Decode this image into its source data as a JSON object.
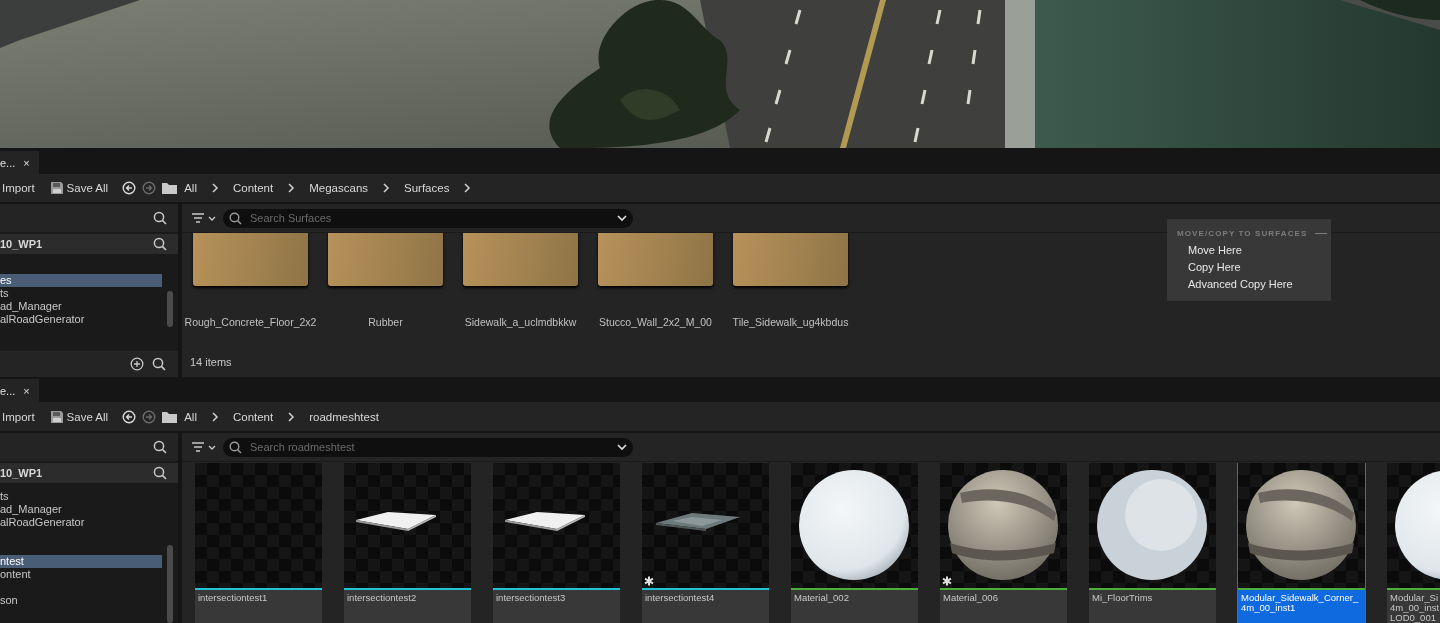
{
  "browsers": [
    {
      "tab": {
        "label": "e...",
        "close": "×"
      },
      "toolbar": {
        "import": "Import",
        "save_all": "Save All"
      },
      "breadcrumbs": [
        "All",
        "Content",
        "Megascans",
        "Surfaces"
      ],
      "trailing_chevron": true,
      "sidebar": {
        "header": "10_WP1",
        "footer": true,
        "items": [
          {
            "kind": "spacer"
          },
          {
            "kind": "spacer"
          },
          {
            "kind": "item",
            "label": "es",
            "selected": true
          },
          {
            "kind": "item",
            "label": "ts",
            "selected": false
          },
          {
            "kind": "item",
            "label": "ad_Manager",
            "selected": false
          },
          {
            "kind": "item",
            "label": "alRoadGenerator",
            "selected": false
          }
        ]
      },
      "search": {
        "placeholder": "Search Surfaces"
      },
      "tiles": [
        {
          "kind": "folder",
          "lines": [
            "Rough_Concrete_Floor_2x2"
          ],
          "selected": false,
          "modified": false
        },
        {
          "kind": "folder",
          "lines": [
            "Rubber"
          ],
          "selected": false,
          "modified": false
        },
        {
          "kind": "folder",
          "lines": [
            "Sidewalk_a_uclmdbkkw"
          ],
          "selected": false,
          "modified": false
        },
        {
          "kind": "folder",
          "lines": [
            "Stucco_Wall_2x2_M_00"
          ],
          "selected": false,
          "modified": false
        },
        {
          "kind": "folder",
          "lines": [
            "Tile_Sidewalk_ug4kbdus"
          ],
          "selected": false,
          "modified": false
        }
      ],
      "status": "14 items",
      "context_menu": {
        "heading": "MOVE/COPY TO SURFACES",
        "items": [
          "Move Here",
          "Copy Here",
          "Advanced Copy Here"
        ]
      }
    },
    {
      "tab": {
        "label": "e...",
        "close": "×"
      },
      "toolbar": {
        "import": "Import",
        "save_all": "Save All"
      },
      "breadcrumbs": [
        "All",
        "Content",
        "roadmeshtest"
      ],
      "trailing_chevron": false,
      "sidebar": {
        "header": "10_WP1",
        "footer": false,
        "items": [
          {
            "kind": "spacer"
          },
          {
            "kind": "item",
            "label": "ts",
            "selected": false
          },
          {
            "kind": "item",
            "label": "ad_Manager",
            "selected": false
          },
          {
            "kind": "item",
            "label": "alRoadGenerator",
            "selected": false
          },
          {
            "kind": "spacer"
          },
          {
            "kind": "spacer"
          },
          {
            "kind": "item",
            "label": "ntest",
            "selected": true
          },
          {
            "kind": "item",
            "label": "ontent",
            "selected": false
          },
          {
            "kind": "spacer"
          },
          {
            "kind": "item",
            "label": "son",
            "selected": false
          }
        ]
      },
      "search": {
        "placeholder": "Search roadmeshtest"
      },
      "tiles": [
        {
          "kind": "mesh",
          "lines": [
            "intersectiontest1"
          ],
          "selected": false,
          "modified": false
        },
        {
          "kind": "mesh",
          "lines": [
            "intersectiontest2"
          ],
          "selected": false,
          "modified": false
        },
        {
          "kind": "mesh",
          "lines": [
            "intersectiontest3"
          ],
          "selected": false,
          "modified": false
        },
        {
          "kind": "mesh",
          "lines": [
            "intersectiontest4"
          ],
          "selected": false,
          "modified": true
        },
        {
          "kind": "material",
          "lines": [
            "Material_002"
          ],
          "selected": false,
          "modified": false
        },
        {
          "kind": "material",
          "lines": [
            "Material_006"
          ],
          "selected": false,
          "modified": true
        },
        {
          "kind": "material",
          "lines": [
            "Mi_FloorTrims"
          ],
          "selected": false,
          "modified": false
        },
        {
          "kind": "material",
          "lines": [
            "Modular_Sidewalk_Corner_",
            "4m_00_inst1"
          ],
          "selected": true,
          "modified": false
        },
        {
          "kind": "material",
          "lines": [
            "Modular_Si",
            "4m_00_inst",
            "LOD0_001"
          ],
          "selected": false,
          "modified": false
        }
      ]
    }
  ]
}
